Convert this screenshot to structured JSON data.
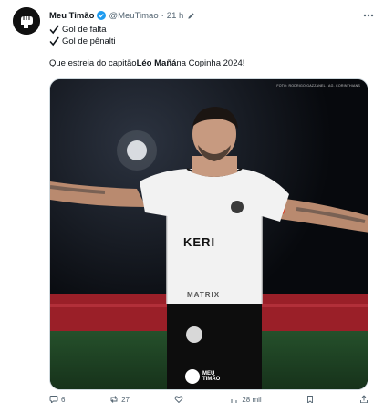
{
  "author": {
    "display_name": "Meu Timão",
    "handle": "@MeuTimao",
    "separator": "·",
    "time": "21 h"
  },
  "tweet": {
    "line1": "Gol de falta",
    "line2": "Gol de pênalti",
    "text_pre": "Que estreia do capitão ",
    "text_bold": "Léo Mañá",
    "text_post": " na Copinha 2024!"
  },
  "media": {
    "photo_credit": "FOTO: RODRIGO GAZZANEL / AG. CORINTHIANS",
    "jersey_sponsor": "KERI",
    "jersey_chest": "MATRIX",
    "watermark_line1": "MEU",
    "watermark_line2": "TIMÃO"
  },
  "actions": {
    "reply_count": "6",
    "repost_count": "27",
    "like_count": "",
    "views_count": "28 mil"
  },
  "colors": {
    "verified": "#1d9bf0",
    "text_primary": "#0f1419",
    "text_secondary": "#536471",
    "jersey": "#f2f2f2",
    "board_red": "#9a1f28",
    "pitch": "#1f3f22"
  }
}
